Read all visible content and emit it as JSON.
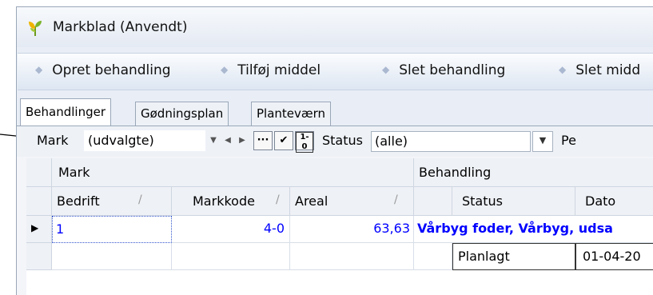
{
  "window": {
    "title": "Markblad (Anvendt)",
    "icon": "plant-leaf-icon"
  },
  "toolbar": {
    "items": [
      {
        "label": "Opret behandling"
      },
      {
        "label": "Tilføj middel"
      },
      {
        "label": "Slet behandling"
      },
      {
        "label": "Slet midd"
      }
    ]
  },
  "tabs": [
    {
      "label": "Behandlinger",
      "active": true
    },
    {
      "label": "Gødningsplan",
      "active": false
    },
    {
      "label": "Planteværn",
      "active": false
    }
  ],
  "filter": {
    "mark_label": "Mark",
    "mark_value": "(udvalgte)",
    "btn_ellipsis": "···",
    "btn_check": "✔",
    "btn_onezero": "1-0",
    "status_label": "Status",
    "status_value": "(alle)",
    "next_label": "Pe"
  },
  "grid": {
    "group_headers": {
      "mark": "Mark",
      "behandling": "Behandling"
    },
    "columns": {
      "bedrift": "Bedrift",
      "markkode": "Markkode",
      "areal": "Areal",
      "status": "Status",
      "dato": "Dato"
    },
    "row1": {
      "bedrift": "1",
      "markkode": "4-0",
      "areal": "63,63",
      "behandling": "Vårbyg foder, Vårbyg, udsa"
    },
    "row2": {
      "status": "Planlagt",
      "dato": "01-04-20"
    }
  },
  "colors": {
    "accent_text": "#0000ff",
    "selection_border": "#3355cc"
  }
}
